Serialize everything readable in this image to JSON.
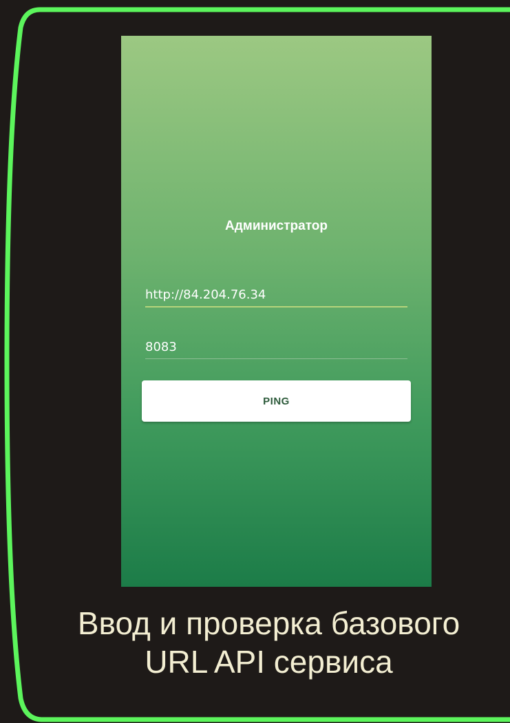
{
  "colors": {
    "background": "#1e1a18",
    "frame_border": "#5cf55c",
    "caption_text": "#f3eed2",
    "gradient_top": "#9cc882",
    "gradient_bottom": "#1c7c48",
    "button_text": "#2c5a3a"
  },
  "screen": {
    "title": "Администратор",
    "url_field": {
      "value": "http://84.204.76.34"
    },
    "port_field": {
      "value": "8083"
    },
    "ping_button_label": "PING"
  },
  "caption": {
    "line1": "Ввод и проверка базового",
    "line2": "URL API сервиса"
  }
}
